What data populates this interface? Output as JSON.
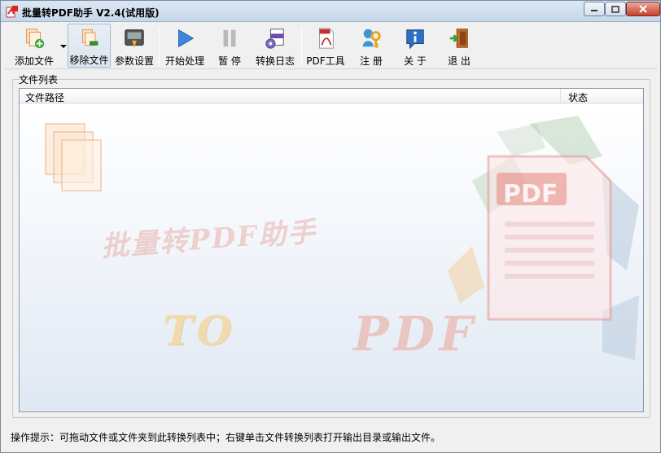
{
  "window": {
    "title": "批量转PDF助手 V2.4(试用版)"
  },
  "toolbar": {
    "add_file": "添加文件",
    "remove_file": "移除文件",
    "settings": "参数设置",
    "start": "开始处理",
    "pause": "暂 停",
    "log": "转换日志",
    "pdf_tools": "PDF工具",
    "register": "注 册",
    "about": "关 于",
    "exit": "退 出"
  },
  "file_list": {
    "group_label": "文件列表",
    "columns": {
      "path": "文件路径",
      "status": "状态"
    },
    "rows": []
  },
  "watermark": {
    "title": "批量转PDF助手",
    "to": "TO",
    "pdf": "PDF",
    "doc_label": "PDF"
  },
  "status": {
    "hint": "操作提示：可拖动文件或文件夹到此转换列表中；右键单击文件转换列表打开输出目录或输出文件。"
  }
}
